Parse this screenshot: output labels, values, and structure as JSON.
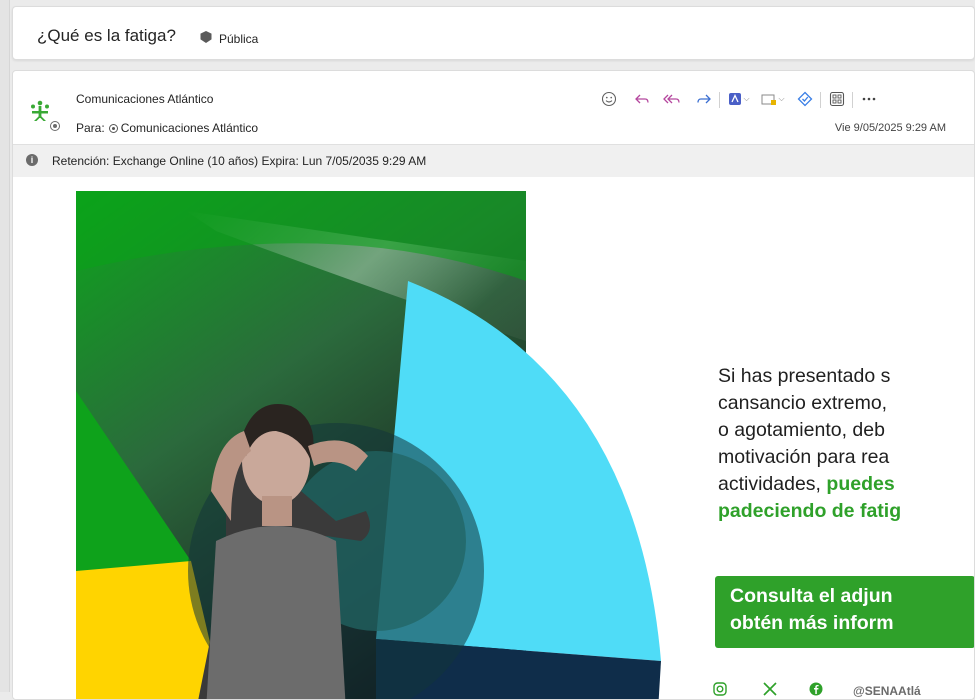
{
  "subject": {
    "title": "¿Qué es la fatiga?",
    "sensitivity_label": "Pública"
  },
  "message": {
    "sender_name": "Comunicaciones Atlántico",
    "to_prefix": "Para:",
    "to_name": "Comunicaciones Atlántico",
    "date": "Vie 9/05/2025 9:29 AM",
    "toolbar_icons": [
      "emoji-icon",
      "reply-icon",
      "reply-all-icon",
      "forward-icon",
      "apps-icon",
      "print-preview-icon",
      "translate-icon",
      "grid-icon",
      "more-icon"
    ]
  },
  "retention": {
    "text": "Retención: Exchange Online (10 años) Expira: Lun 7/05/2035 9:29 AM"
  },
  "body": {
    "lines": [
      "Si has presentado s",
      "cansancio extremo,",
      "o agotamiento, deb",
      "motivación para rea"
    ],
    "line5_normal": "actividades, ",
    "line5_green": "puedes",
    "line6_green": "padeciendo de fatig",
    "cta_line1": "Consulta el adjun",
    "cta_line2": "obtén más inform",
    "social_handle": "@SENAAtlá"
  },
  "colors": {
    "brand_green": "#2fa12a",
    "cyan": "#4fdcf7",
    "yellow": "#ffd400",
    "navy": "#0f2d4a",
    "sena_green": "#39a935"
  }
}
